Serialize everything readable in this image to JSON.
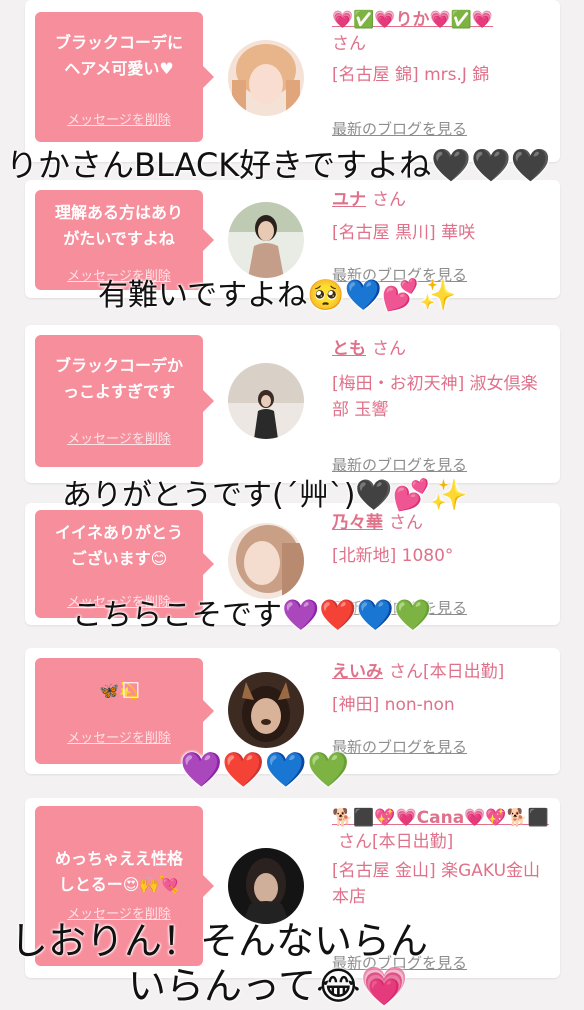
{
  "cards": [
    {
      "bubble_message": "ブラックコーデに\nヘアメ可愛い♥",
      "delete_label": "メッセージを削除",
      "name": "💗✅💗りか💗✅💗",
      "san": "さん",
      "store": "[名古屋 錦] mrs.J 錦",
      "blog_label": "最新のブログを見る"
    },
    {
      "bubble_message": "理解ある方はあり\nがたいですよね",
      "delete_label": "メッセージを削除",
      "name": "ユナ",
      "san": "さん",
      "store": "[名古屋 黒川] 華咲",
      "blog_label": "最新のブログを見る"
    },
    {
      "bubble_message": "ブラックコーデか\nっこよすぎです",
      "delete_label": "メッセージを削除",
      "name": "とも",
      "san": "さん",
      "store": "[梅田・お初天神] 淑女倶楽部 玉響",
      "blog_label": "最新のブログを見る"
    },
    {
      "bubble_message": "イイネありがとう\nございます😊",
      "delete_label": "メッセージを削除",
      "name": "乃々華",
      "san": "さん",
      "store": "[北新地] 1080°",
      "blog_label": "最新のブログを見る"
    },
    {
      "bubble_message": "🦋💫⃞",
      "delete_label": "メッセージを削除",
      "name": "えいみ",
      "san": "さん[本日出勤]",
      "store": "[神田] non-non",
      "blog_label": "最新のブログを見る"
    },
    {
      "bubble_message": "めっちゃええ性格\nしとるー😍🙌💘",
      "delete_label": "メッセージを削除",
      "name": "🐕⬛💖💗Cana💗💖🐕⬛",
      "san": "さん[本日出勤]",
      "store": "[名古屋 金山] 楽GAKU金山本店",
      "blog_label": "最新のブログを見る"
    }
  ],
  "overlays": [
    "りかさんBLACK好きですよね🖤🖤🖤",
    "有難いですよね🥺💙💕✨",
    "ありがとうです(´艸`)🖤💕✨",
    "こちらこそです💜❤️💙💚",
    "💜❤️💙💚",
    "しおりん！そんないらん",
    "いらんって😂💗"
  ],
  "colors": {
    "background": "#f3f1f1",
    "bubble": "#f78e9c",
    "name_pink": "#e0718a",
    "blog_gray": "#8d8d8d"
  }
}
